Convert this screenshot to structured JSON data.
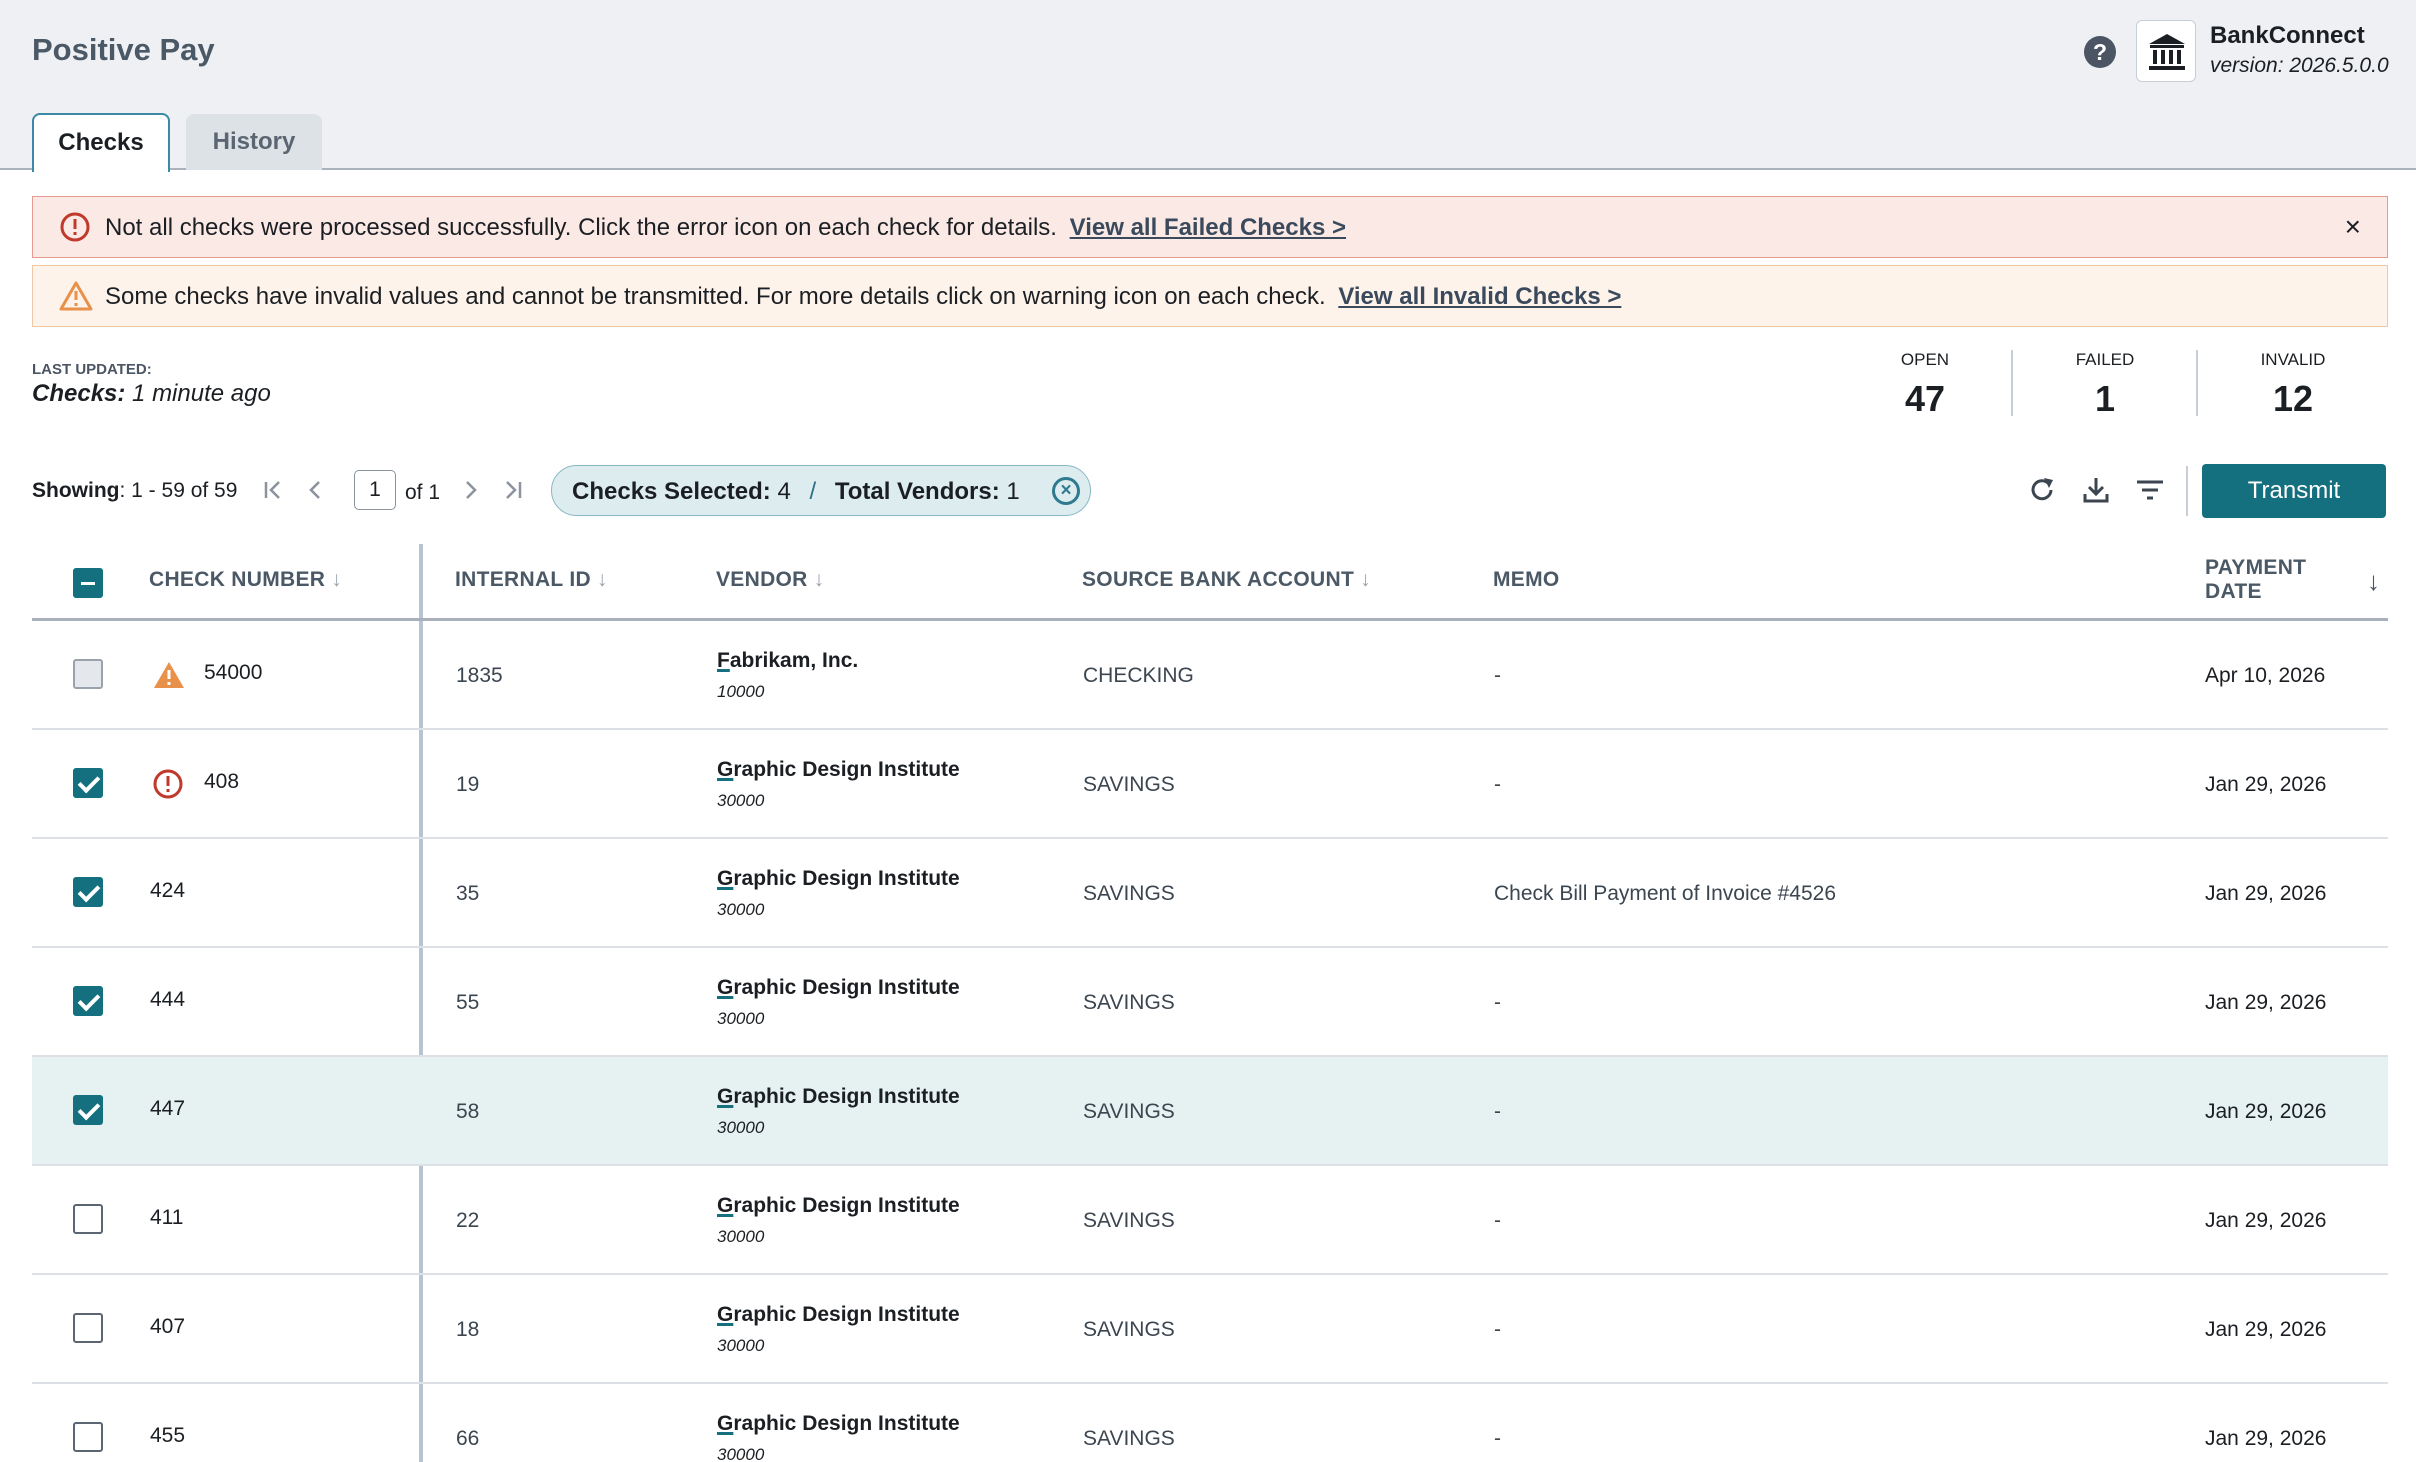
{
  "header": {
    "title": "Positive Pay",
    "brand_name": "BankConnect",
    "version": "version: 2026.5.0.0",
    "help_icon": "question-circle-icon",
    "bank_icon": "bank-building-icon"
  },
  "tabs": [
    {
      "label": "Checks",
      "active": true
    },
    {
      "label": "History",
      "active": false
    }
  ],
  "banners": {
    "error": {
      "text": "Not all checks were processed successfully. Click the error icon on each check for details.",
      "link": "View all Failed Checks >"
    },
    "warning": {
      "text": "Some checks have invalid values and cannot be transmitted. For more details click on warning icon on each check.",
      "link": "View all Invalid Checks >"
    }
  },
  "last_updated": {
    "label": "LAST UPDATED:",
    "subject": "Checks:",
    "value": "1 minute ago"
  },
  "stats": {
    "open": {
      "label": "OPEN",
      "value": "47"
    },
    "failed": {
      "label": "FAILED",
      "value": "1"
    },
    "invalid": {
      "label": "INVALID",
      "value": "12"
    }
  },
  "toolbar": {
    "showing_label": "Showing",
    "showing_value": ": 1 - 59 of 59",
    "page": "1",
    "page_of": "of 1",
    "checks_selected_label": "Checks Selected:",
    "checks_selected_value": "4",
    "separator": "/",
    "total_vendors_label": "Total Vendors:",
    "total_vendors_value": "1",
    "transmit_label": "Transmit"
  },
  "table": {
    "columns": {
      "check_number": "CHECK NUMBER",
      "internal_id": "INTERNAL ID",
      "vendor": "VENDOR",
      "source_bank_account": "SOURCE BANK ACCOUNT",
      "memo": "MEMO",
      "payment_date_1": "PAYMENT",
      "payment_date_2": "DATE"
    },
    "rows": [
      {
        "checked": "disabled",
        "status": "warning",
        "check_number": "54000",
        "internal_id": "1835",
        "vendor_first": "F",
        "vendor_rest": "abrikam, Inc.",
        "vendor_code": "10000",
        "account": "CHECKING",
        "memo": "-",
        "date": "Apr 10, 2026"
      },
      {
        "checked": "checked",
        "status": "error",
        "check_number": "408",
        "internal_id": "19",
        "vendor_first": "G",
        "vendor_rest": "raphic Design Institute",
        "vendor_code": "30000",
        "account": "SAVINGS",
        "memo": "-",
        "date": "Jan 29, 2026"
      },
      {
        "checked": "checked",
        "status": "",
        "check_number": "424",
        "internal_id": "35",
        "vendor_first": "G",
        "vendor_rest": "raphic Design Institute",
        "vendor_code": "30000",
        "account": "SAVINGS",
        "memo": "Check Bill Payment of Invoice #4526",
        "date": "Jan 29, 2026"
      },
      {
        "checked": "checked",
        "status": "",
        "check_number": "444",
        "internal_id": "55",
        "vendor_first": "G",
        "vendor_rest": "raphic Design Institute",
        "vendor_code": "30000",
        "account": "SAVINGS",
        "memo": "-",
        "date": "Jan 29, 2026"
      },
      {
        "checked": "checked",
        "status": "",
        "check_number": "447",
        "internal_id": "58",
        "vendor_first": "G",
        "vendor_rest": "raphic Design Institute",
        "vendor_code": "30000",
        "account": "SAVINGS",
        "memo": "-",
        "date": "Jan 29, 2026"
      },
      {
        "checked": "unchecked",
        "status": "",
        "check_number": "411",
        "internal_id": "22",
        "vendor_first": "G",
        "vendor_rest": "raphic Design Institute",
        "vendor_code": "30000",
        "account": "SAVINGS",
        "memo": "-",
        "date": "Jan 29, 2026"
      },
      {
        "checked": "unchecked",
        "status": "",
        "check_number": "407",
        "internal_id": "18",
        "vendor_first": "G",
        "vendor_rest": "raphic Design Institute",
        "vendor_code": "30000",
        "account": "SAVINGS",
        "memo": "-",
        "date": "Jan 29, 2026"
      },
      {
        "checked": "unchecked",
        "status": "",
        "check_number": "455",
        "internal_id": "66",
        "vendor_first": "G",
        "vendor_rest": "raphic Design Institute",
        "vendor_code": "30000",
        "account": "SAVINGS",
        "memo": "-",
        "date": "Jan 29, 2026"
      }
    ]
  },
  "colors": {
    "primary": "#14707f",
    "error": "#c0392b",
    "warning": "#e8914a",
    "row_highlight": "#e6f1f2"
  }
}
